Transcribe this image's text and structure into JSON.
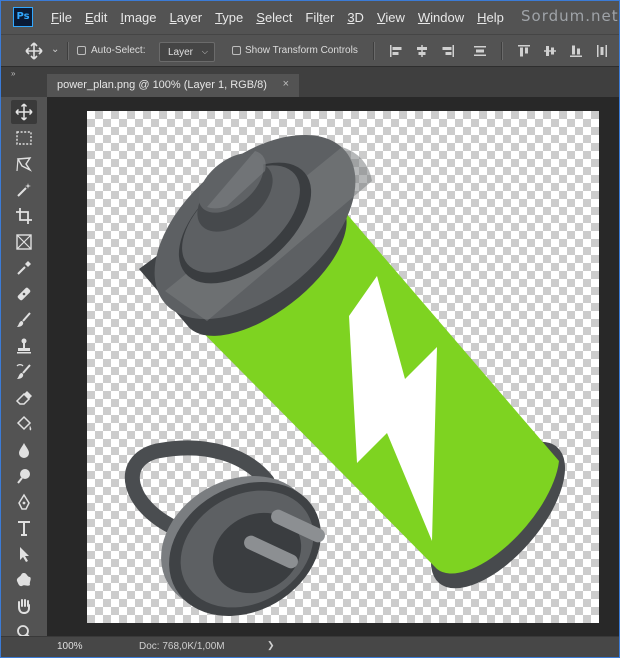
{
  "app": {
    "logo_text": "Ps",
    "brand": "Sordum.net",
    "menu": [
      {
        "u": "F",
        "rest": "ile"
      },
      {
        "u": "E",
        "rest": "dit"
      },
      {
        "u": "I",
        "rest": "mage"
      },
      {
        "u": "L",
        "rest": "ayer"
      },
      {
        "u": "T",
        "rest": "ype"
      },
      {
        "u": "S",
        "rest": "elect"
      },
      {
        "u": "F",
        "rest": "ilter",
        "pre": "Fil",
        "post": "ter"
      },
      {
        "u": "3",
        "rest": "D"
      },
      {
        "u": "V",
        "rest": "iew"
      },
      {
        "u": "W",
        "rest": "indow"
      },
      {
        "u": "H",
        "rest": "elp"
      }
    ]
  },
  "options": {
    "auto_select_label": "Auto-Select:",
    "auto_select_checked": false,
    "target_value": "Layer",
    "transform_label": "Show Transform Controls",
    "transform_checked": false
  },
  "document": {
    "tab_title": "power_plan.png @ 100% (Layer 1, RGB/8)",
    "close_glyph": "×"
  },
  "status": {
    "zoom": "100%",
    "doc": "Doc: 768,0K/1,00M"
  },
  "toolbar": {
    "collapse_glyph": "»",
    "tools": [
      "move-tool",
      "marquee-tool",
      "lasso-tool",
      "magic-wand-tool",
      "crop-tool",
      "frame-tool",
      "eyedropper-tool",
      "healing-tool",
      "brush-tool",
      "stamp-tool",
      "history-brush-tool",
      "eraser-tool",
      "paint-bucket-tool",
      "blur-tool",
      "dodge-tool",
      "pen-tool",
      "type-tool",
      "path-selection-tool",
      "shape-tool",
      "hand-tool",
      "zoom-tool"
    ]
  },
  "colors": {
    "battery_green": "#7ed321",
    "battery_cap": "#4a4d50",
    "accent_blue": "#31a8ff"
  }
}
